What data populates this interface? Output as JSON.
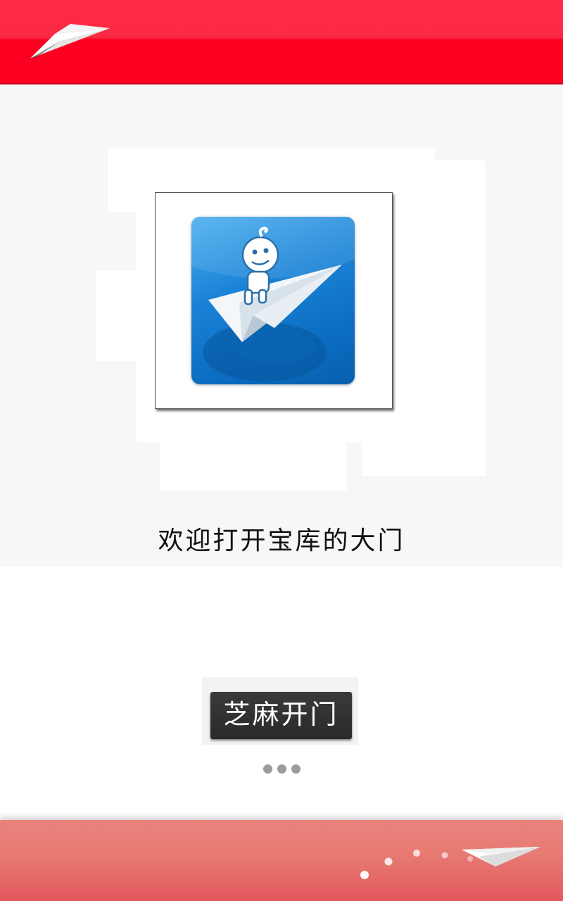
{
  "welcome": {
    "text": "欢迎打开宝库的大门"
  },
  "button": {
    "label": "芝麻开门"
  },
  "pager": {
    "dot_count": 3
  },
  "colors": {
    "header_red": "#fc0022",
    "footer_coral": "#e87b74",
    "button_dark": "#2f2f2f",
    "icon_blue": "#1a82d6",
    "dot_gray": "#9b9b9b"
  },
  "icons": {
    "header": "paper-plane-icon",
    "app": "baby-riding-paper-plane-logo",
    "footer": "paper-plane-trail-icon"
  }
}
